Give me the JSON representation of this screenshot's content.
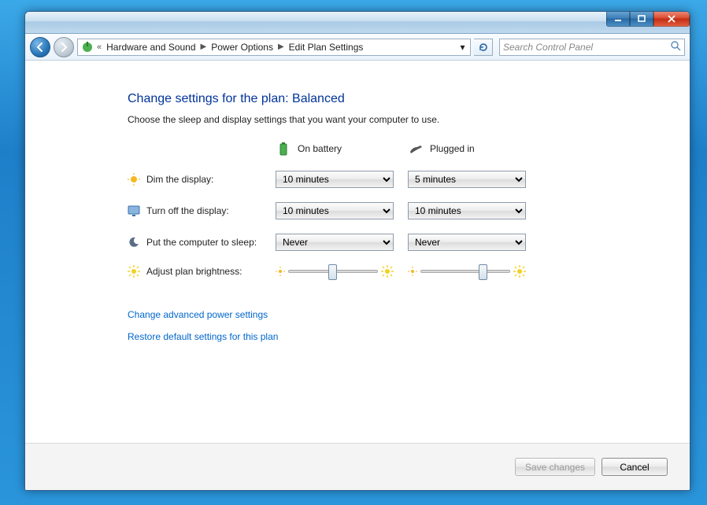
{
  "breadcrumb": {
    "seg1": "Hardware and Sound",
    "seg2": "Power Options",
    "seg3": "Edit Plan Settings"
  },
  "search": {
    "placeholder": "Search Control Panel"
  },
  "heading": "Change settings for the plan: Balanced",
  "subtext": "Choose the sleep and display settings that you want your computer to use.",
  "columns": {
    "battery": "On battery",
    "plugged": "Plugged in"
  },
  "rows": {
    "dim": {
      "label": "Dim the display:",
      "battery": "10 minutes",
      "plugged": "5 minutes"
    },
    "off": {
      "label": "Turn off the display:",
      "battery": "10 minutes",
      "plugged": "10 minutes"
    },
    "sleep": {
      "label": "Put the computer to sleep:",
      "battery": "Never",
      "plugged": "Never"
    },
    "brightness": {
      "label": "Adjust plan brightness:",
      "battery_pct": 45,
      "plugged_pct": 65
    }
  },
  "links": {
    "advanced": "Change advanced power settings",
    "restore": "Restore default settings for this plan"
  },
  "buttons": {
    "save": "Save changes",
    "cancel": "Cancel"
  }
}
